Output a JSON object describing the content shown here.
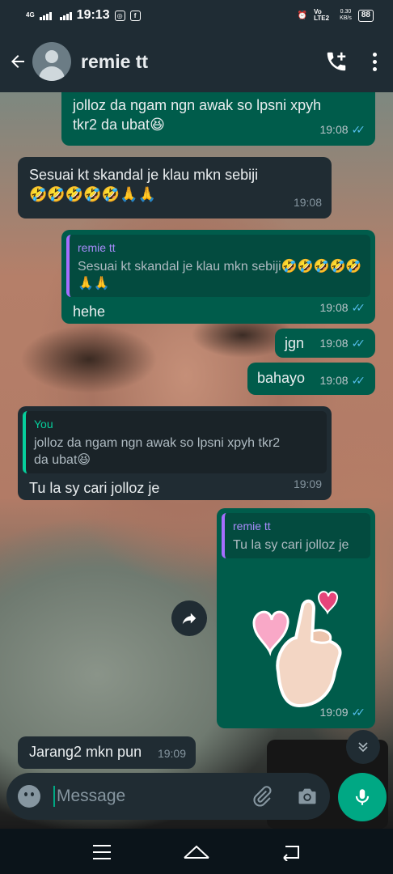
{
  "status_bar": {
    "network": "4G",
    "time": "19:13",
    "volte": "Vo LTE2",
    "speed_value": "0.30",
    "speed_unit": "KB/s",
    "battery": "88"
  },
  "header": {
    "contact_name": "remie tt"
  },
  "messages": [
    {
      "direction": "out",
      "text": "jolloz da ngam ngn awak so lpsni xpyh tkr2 da ubat😆",
      "time": "19:08",
      "status": "read"
    },
    {
      "direction": "in",
      "text": "Sesuai kt skandal je klau mkn sebiji🤣🤣🤣🤣🤣🙏🙏",
      "time": "19:08"
    },
    {
      "direction": "out",
      "quote_name": "remie tt",
      "quote_text": "Sesuai kt skandal je klau mkn sebiji🤣🤣🤣🤣🤣🙏🙏",
      "text": "hehe",
      "time": "19:08",
      "status": "read"
    },
    {
      "direction": "out",
      "text": "jgn",
      "time": "19:08",
      "status": "read"
    },
    {
      "direction": "out",
      "text": "bahayo",
      "time": "19:08",
      "status": "read"
    },
    {
      "direction": "in",
      "quote_name": "You",
      "quote_text": "jolloz da ngam ngn awak so lpsni xpyh tkr2 da ubat😆",
      "text": "Tu la sy cari jolloz je",
      "time": "19:09"
    },
    {
      "direction": "out",
      "quote_name": "remie tt",
      "quote_text": "Tu la sy cari jolloz je",
      "sticker": "finger-heart-sticker",
      "time": "19:09",
      "status": "read"
    },
    {
      "direction": "in",
      "text": "Jarang2 mkn pun",
      "time": "19:09"
    }
  ],
  "composer": {
    "placeholder": "Message"
  },
  "colors": {
    "header_bg": "#1f2c34",
    "outgoing_bubble": "#005c4b",
    "incoming_bubble": "#202c33",
    "accent": "#00a884",
    "read_ticks": "#53bdeb"
  },
  "icons": [
    "back-arrow-icon",
    "avatar-icon",
    "add-call-icon",
    "more-options-icon",
    "forward-icon",
    "scroll-down-icon",
    "emoji-icon",
    "attach-icon",
    "camera-icon",
    "mic-icon",
    "nav-menu-icon",
    "nav-home-icon",
    "nav-back-icon"
  ]
}
